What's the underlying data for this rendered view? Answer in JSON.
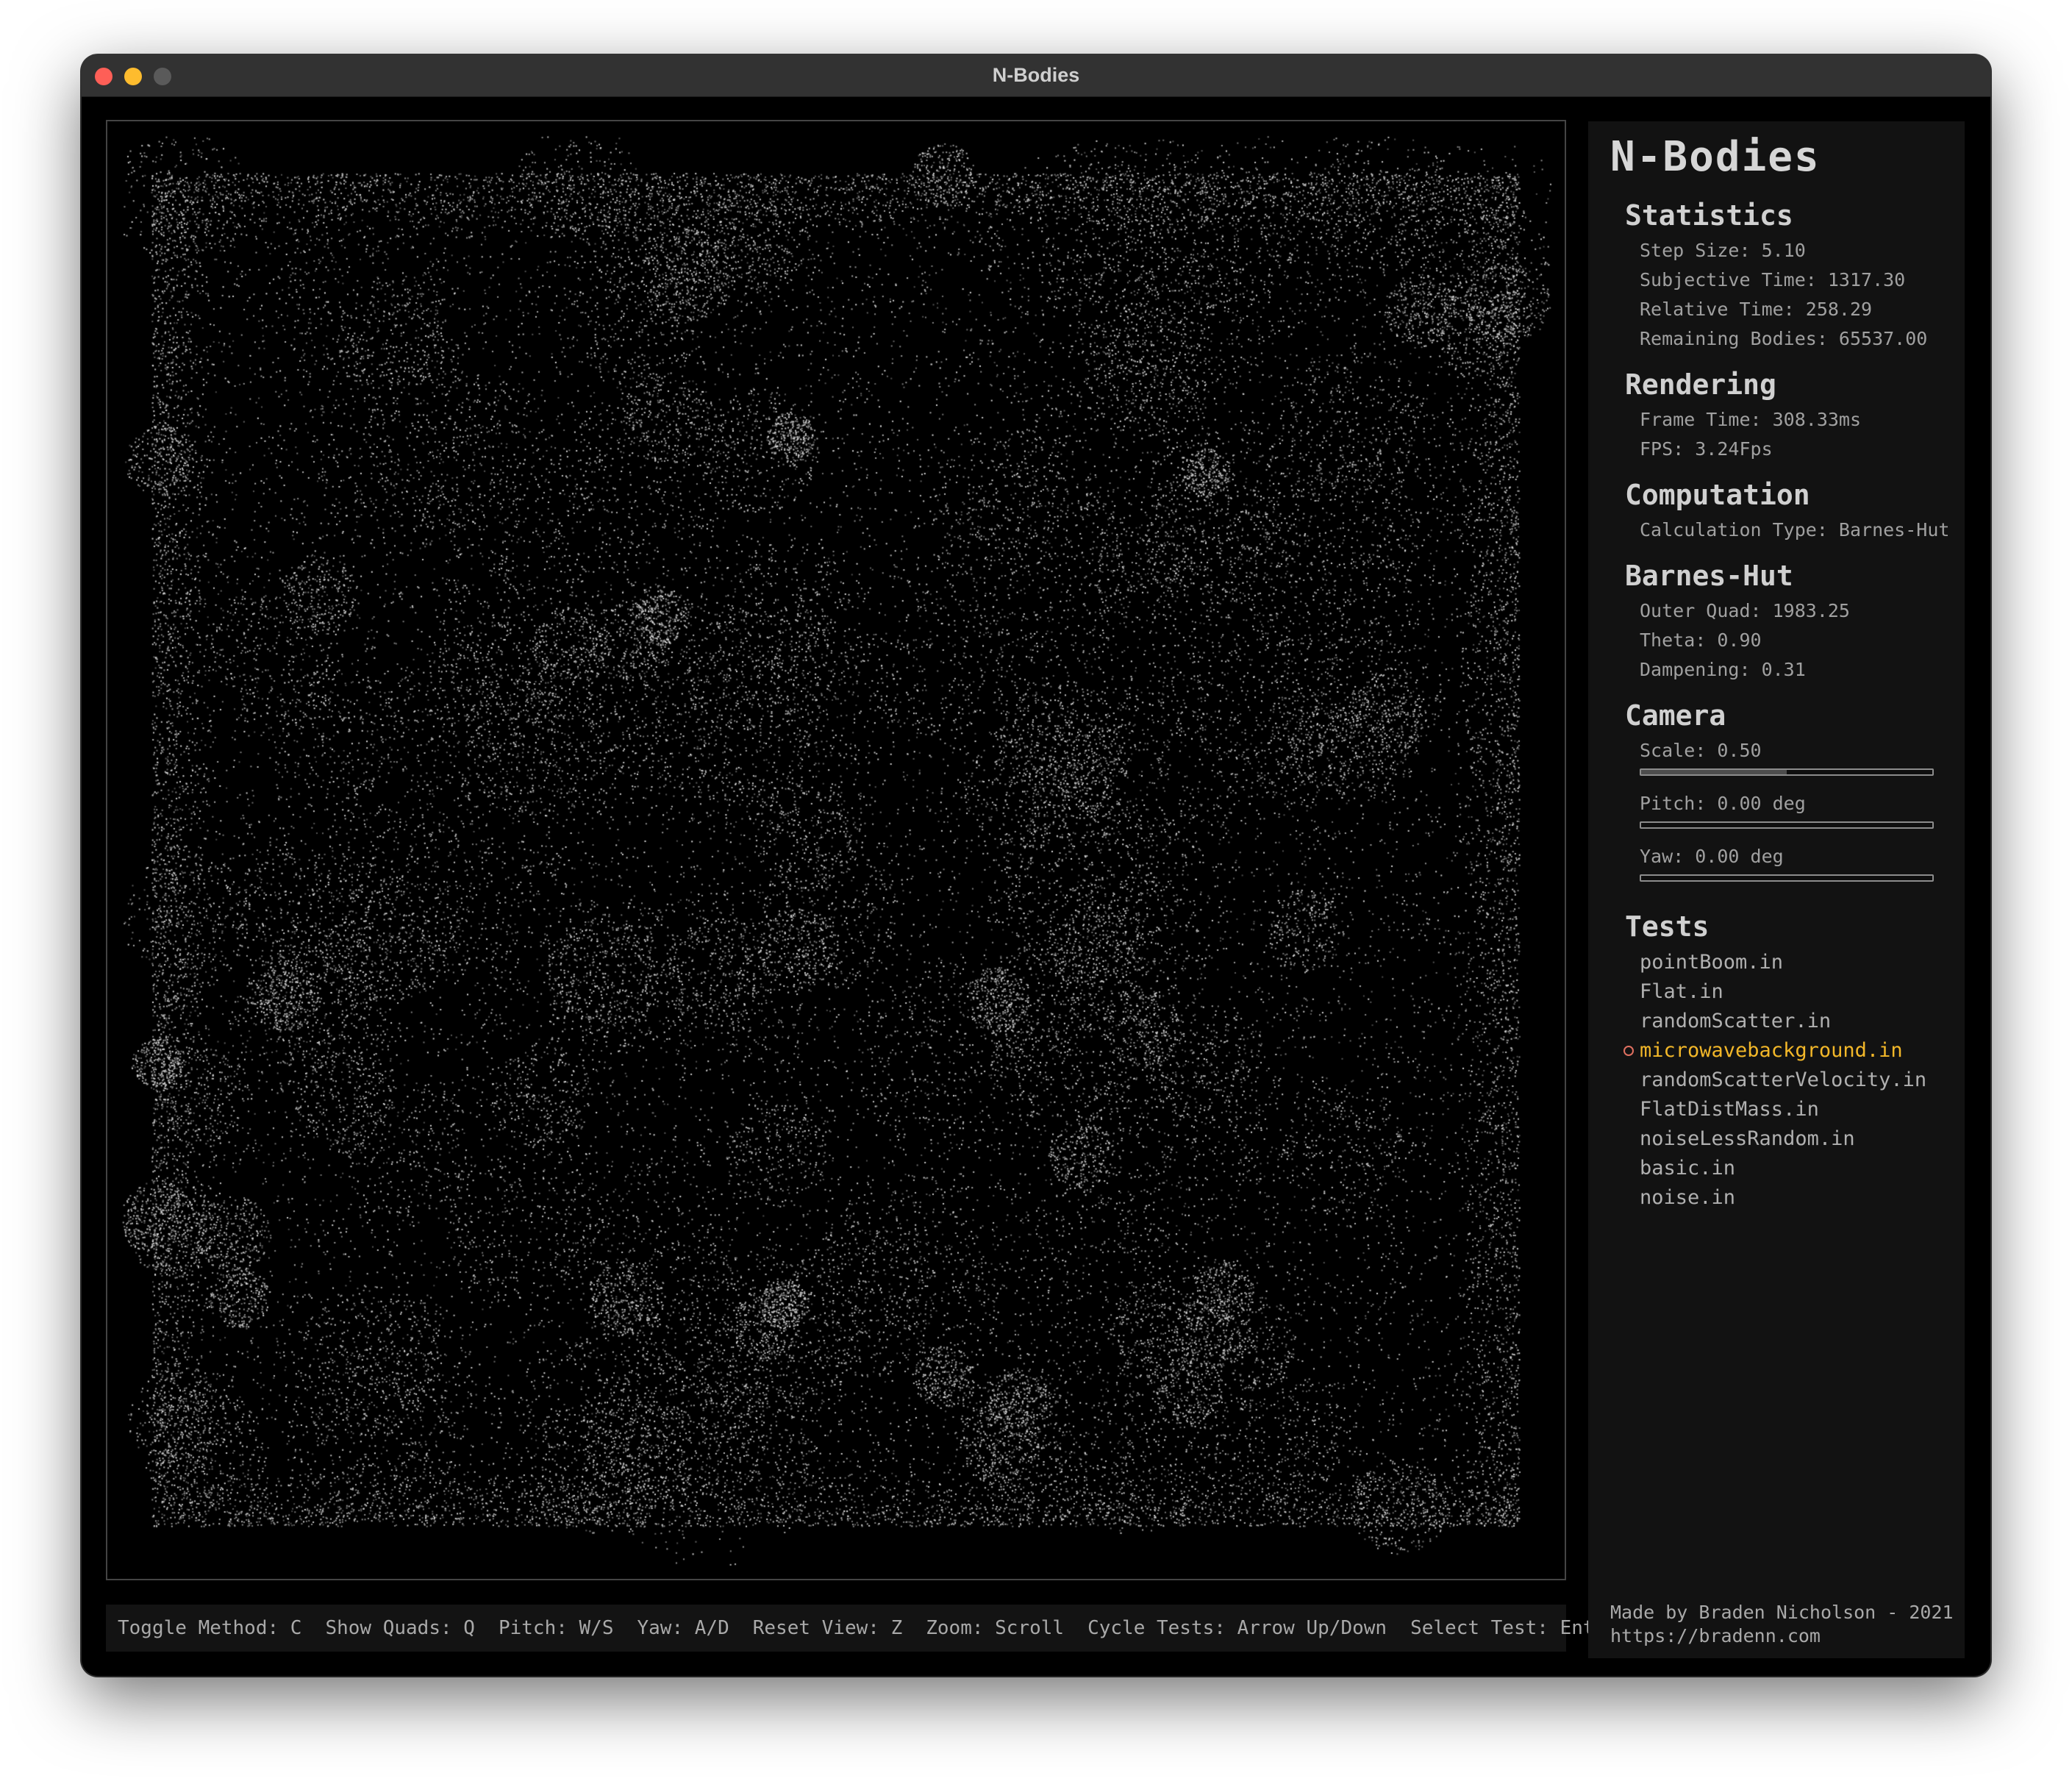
{
  "window": {
    "title": "N-Bodies"
  },
  "sidebar": {
    "app_title": "N-Bodies",
    "statistics": {
      "heading": "Statistics",
      "items": [
        "Step Size: 5.10",
        "Subjective Time: 1317.30",
        "Relative Time: 258.29",
        "Remaining Bodies: 65537.00"
      ]
    },
    "rendering": {
      "heading": "Rendering",
      "items": [
        "Frame Time: 308.33ms",
        "FPS: 3.24Fps"
      ]
    },
    "computation": {
      "heading": "Computation",
      "items": [
        "Calculation Type: Barnes-Hut"
      ]
    },
    "barnes_hut": {
      "heading": "Barnes-Hut",
      "items": [
        "Outer Quad: 1983.25",
        "Theta: 0.90",
        "Dampening: 0.31"
      ]
    },
    "camera": {
      "heading": "Camera",
      "scale": {
        "label": "Scale: 0.50",
        "level": 0.5
      },
      "pitch": {
        "label": "Pitch: 0.00 deg",
        "level": 0.0
      },
      "yaw": {
        "label": "Yaw: 0.00 deg",
        "level": 0.0
      }
    },
    "tests": {
      "heading": "Tests",
      "items": [
        "pointBoom.in",
        "Flat.in",
        "randomScatter.in",
        "microwavebackground.in",
        "randomScatterVelocity.in",
        "FlatDistMass.in",
        "noiseLessRandom.in",
        "basic.in",
        "noise.in"
      ],
      "selected": "microwavebackground.in"
    },
    "credit": {
      "line1": "Made by Braden Nicholson - 2021",
      "line2": "https://bradenn.com"
    }
  },
  "controls": [
    "Toggle Method: C",
    "Show Quads: Q",
    "Pitch: W/S",
    "Yaw: A/D",
    "Reset View: Z",
    "Zoom: Scroll",
    "Cycle Tests: Arrow Up/Down",
    "Select Test: Enter"
  ],
  "colors": {
    "selected_test": "#f2b729",
    "particles": "#d8d8d8",
    "background": "#000000"
  }
}
